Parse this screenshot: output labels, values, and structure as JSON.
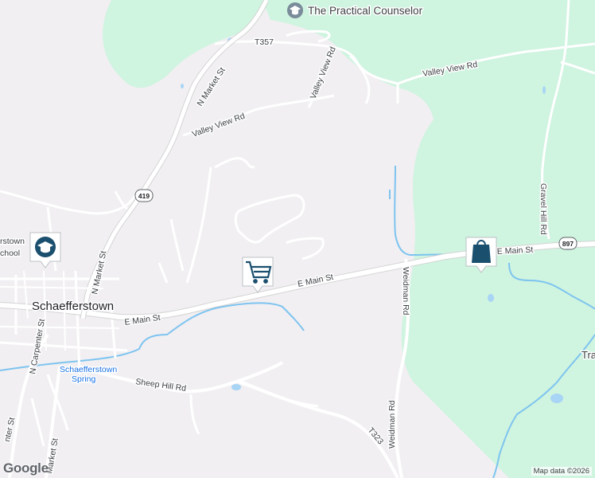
{
  "colors": {
    "land": "#f1eff2",
    "forest": "#cff4e0",
    "water": "#a8d4f5",
    "stream": "#7ec4ef",
    "road": "#ffffff",
    "road_edge": "#d4d4d4",
    "marker": "#1a4f6e"
  },
  "poi": {
    "label": "The Practical Counselor",
    "icon": "graduation-cap-icon"
  },
  "places": {
    "town": "Schaefferstown",
    "school_partial": "rstown\nchool",
    "spring": "Schaefferstown\nSpring",
    "partial_right": "Tra"
  },
  "roads": {
    "valley_view_rd": "Valley View Rd",
    "t357": "T357",
    "n_market_st": "N Market St",
    "e_main_st": "E Main St",
    "weidman_rd": "Weidman Rd",
    "gravel_hill_rd": "Gravel Hill Rd",
    "sheep_hill_rd": "Sheep Hill Rd",
    "n_carpenter_st": "N Carpenter St",
    "t323": "T323",
    "carpenter_partial": "nter St",
    "market_partial": "Market St"
  },
  "shields": {
    "r419": "419",
    "r897": "897"
  },
  "markers": [
    {
      "name": "school",
      "icon": "graduation-cap-icon"
    },
    {
      "name": "grocery",
      "icon": "shopping-cart-icon"
    },
    {
      "name": "shopping",
      "icon": "shopping-bag-icon"
    }
  ],
  "attribution": "Map data ©2026",
  "logo": "Google"
}
